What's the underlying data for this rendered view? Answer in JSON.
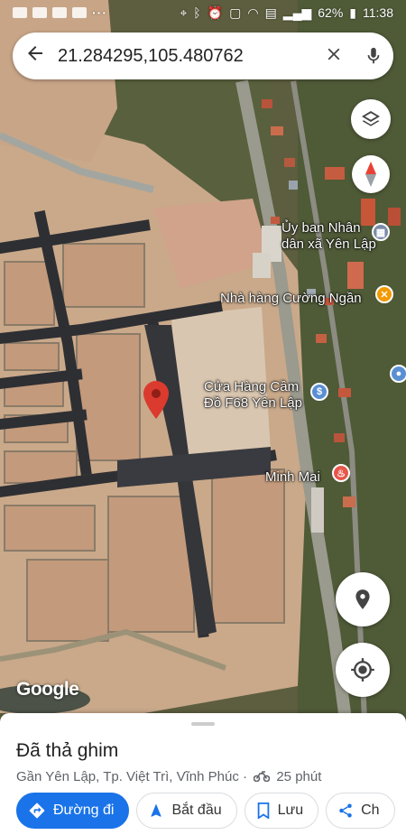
{
  "status_bar": {
    "battery": "62%",
    "time": "11:38",
    "dots": "···"
  },
  "search": {
    "value": "21.284295,105.480762"
  },
  "map": {
    "places": [
      {
        "line1": "Ủy ban Nhân",
        "line2": "dân xã Yên Lập",
        "icon": "government-building-icon",
        "color": "#7b8ba8"
      },
      {
        "line1": "Nhà hàng Cường Ngần",
        "line2": "",
        "icon": "restaurant-icon",
        "color": "#f29900"
      },
      {
        "line1": "Cửa Hàng Cầm",
        "line2": "Đồ F68 Yên Lập",
        "icon": "pawn-shop-icon",
        "color": "#5b8fd4"
      },
      {
        "line1": "Minh Mai",
        "line2": "",
        "icon": "food-icon",
        "color": "#e8564a"
      }
    ],
    "attribution": "Google"
  },
  "place_sheet": {
    "title": "Đã thả ghim",
    "subtitle": "Gần Yên Lập, Tp. Việt Trì, Vĩnh Phúc ·",
    "travel_time": "25 phút",
    "actions": {
      "directions": "Đường đi",
      "start": "Bắt đầu",
      "save": "Lưu",
      "share": "Ch"
    }
  }
}
